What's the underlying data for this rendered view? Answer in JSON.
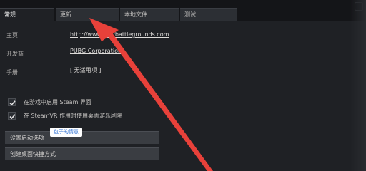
{
  "tabs": [
    {
      "label": "常规",
      "active": true
    },
    {
      "label": "更新",
      "active": false
    },
    {
      "label": "本地文件",
      "active": false
    },
    {
      "label": "测试",
      "active": false
    }
  ],
  "info": {
    "homepage_label": "主页",
    "homepage_value": "http://www.playbattlegrounds.com",
    "developer_label": "开发商",
    "developer_value": "PUBG Corporation",
    "manual_label": "手册",
    "manual_value": "[ 无适用项 ]"
  },
  "options": [
    {
      "label": "在游戏中启用 Steam 界面",
      "checked": true
    },
    {
      "label": "在 SteamVR 作用时使用桌面游乐剧院",
      "checked": true
    }
  ],
  "buttons": {
    "launch_options": "设置启动选项",
    "desktop_shortcut": "创建桌面快捷方式"
  },
  "watermark": "包子的情意",
  "colors": {
    "background": "#1f2125",
    "arrow": "#e8413a",
    "watermark_text": "#2b6fd4"
  }
}
